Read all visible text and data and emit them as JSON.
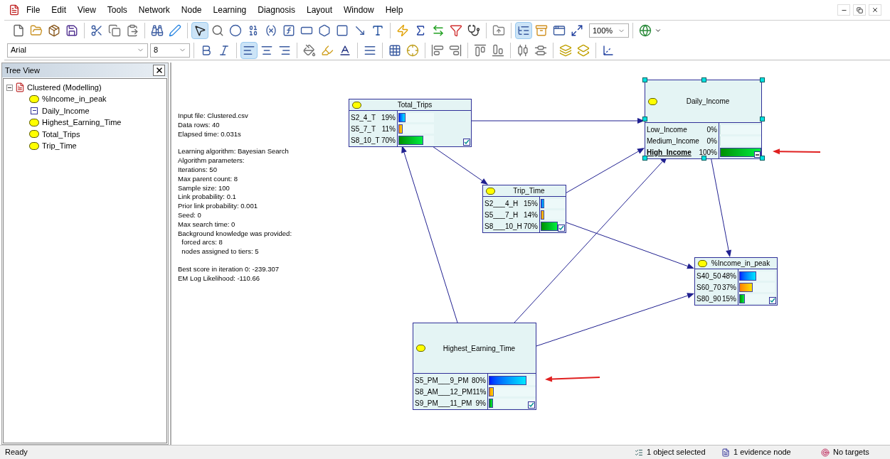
{
  "menu": [
    "File",
    "Edit",
    "View",
    "Tools",
    "Network",
    "Node",
    "Learning",
    "Diagnosis",
    "Layout",
    "Window",
    "Help"
  ],
  "toolbar": {
    "pointer_active": true,
    "tree_view_active": true,
    "align_left_active": true,
    "zoom": "100%",
    "font": "Arial",
    "font_size": "8"
  },
  "tree_view": {
    "title": "Tree View",
    "root": {
      "label": "Clustered (Modelling)",
      "expanded": true,
      "children": [
        {
          "label": "%Income_in_peak",
          "kind": "chance"
        },
        {
          "label": "Daily_Income",
          "kind": "evidence"
        },
        {
          "label": "Highest_Earning_Time",
          "kind": "chance"
        },
        {
          "label": "Total_Trips",
          "kind": "chance"
        },
        {
          "label": "Trip_Time",
          "kind": "chance"
        }
      ]
    }
  },
  "log": [
    [
      "Input file: Clustered.csv",
      "Data rows: 40",
      "Elapsed time: 0.031s"
    ],
    [
      "Learning algorithm: Bayesian Search",
      "Algorithm parameters:",
      "Iterations: 50",
      "Max parent count: 8",
      "Sample size: 100",
      "Link probability: 0.1",
      "Prior link probability: 0.001",
      "Seed: 0",
      "Max search time: 0",
      "Background knowledge was provided:",
      "  forced arcs: 8",
      "  nodes assigned to tiers: 5"
    ],
    [
      "Best score in iteration 0: -239.307",
      "EM Log Likelihood: -110.66"
    ]
  ],
  "nodes": [
    {
      "name": "Total_Trips",
      "selected": false,
      "evidence": false,
      "states": [
        {
          "label": "S2_4_T",
          "value": "19%",
          "level": 0.19,
          "observed": false
        },
        {
          "label": "S5_7_T",
          "value": "11%",
          "level": 0.11,
          "observed": false
        },
        {
          "label": "S8_10_T",
          "value": "70%",
          "level": 0.7,
          "observed": false
        }
      ]
    },
    {
      "name": "Daily_Income",
      "selected": true,
      "evidence": true,
      "states": [
        {
          "label": "Low_Income",
          "value": "0%",
          "level": 0,
          "observed": false
        },
        {
          "label": "Medium_Income",
          "value": "0%",
          "level": 0,
          "observed": false
        },
        {
          "label": "High_Income",
          "value": "100%",
          "level": 1,
          "observed": true
        }
      ]
    },
    {
      "name": "Trip_Time",
      "selected": false,
      "evidence": false,
      "states": [
        {
          "label": "S2___4_H",
          "value": "15%",
          "level": 0.15,
          "observed": false
        },
        {
          "label": "S5___7_H",
          "value": "14%",
          "level": 0.14,
          "observed": false
        },
        {
          "label": "S8___10_H",
          "value": "70%",
          "level": 0.7,
          "observed": false
        }
      ]
    },
    {
      "name": "%Income_in_peak",
      "selected": false,
      "evidence": false,
      "states": [
        {
          "label": "S40_50",
          "value": "48%",
          "level": 0.48,
          "observed": false
        },
        {
          "label": "S60_70",
          "value": "37%",
          "level": 0.37,
          "observed": false
        },
        {
          "label": "S80_90",
          "value": "15%",
          "level": 0.15,
          "observed": false
        }
      ]
    },
    {
      "name": "Highest_Earning_Time",
      "selected": false,
      "evidence": false,
      "states": [
        {
          "label": "S5_PM___9_PM",
          "value": "80%",
          "level": 0.8,
          "observed": false
        },
        {
          "label": "S8_AM___12_PM",
          "value": "11%",
          "level": 0.11,
          "observed": false
        },
        {
          "label": "S9_PM___11_PM",
          "value": "9%",
          "level": 0.09,
          "observed": false
        }
      ]
    }
  ],
  "status_bar": {
    "message": "Ready",
    "selection": "1 object selected",
    "evidence": "1 evidence node",
    "targets": "No targets"
  }
}
